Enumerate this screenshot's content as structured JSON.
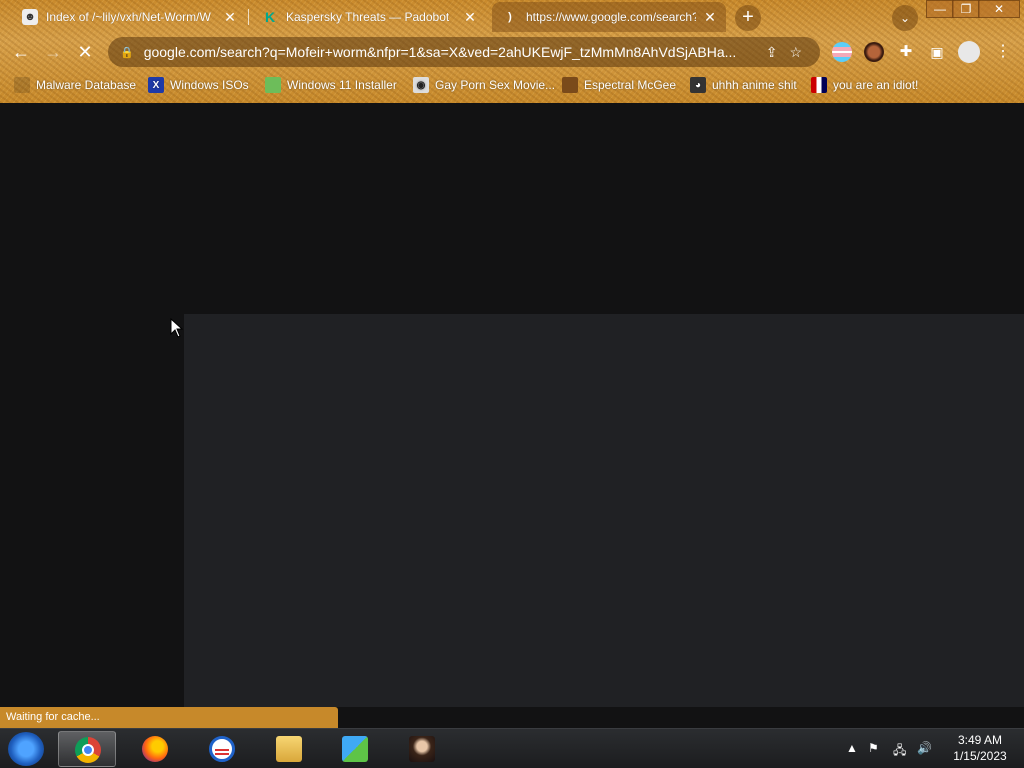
{
  "tabs": [
    {
      "title": "Index of /~lily/vxh/Net-Worm/W",
      "close": "✕"
    },
    {
      "title": "Kaspersky Threats — Padobot",
      "close": "✕"
    },
    {
      "title": "https://www.google.com/search?",
      "close": "✕"
    }
  ],
  "new_tab": "+",
  "window_controls": {
    "minimize": "—",
    "maximize": "❐",
    "close": "✕"
  },
  "toolbar": {
    "url": "google.com/search?q=Mofeir+worm&nfpr=1&sa=X&ved=2ahUKEwjF_tzMmMn8AhVdSjABHa...",
    "back": "←",
    "forward": "→",
    "reload": "✕"
  },
  "bookmarks": [
    {
      "label": "Malware Database"
    },
    {
      "label": "Windows ISOs"
    },
    {
      "label": "Windows 11 Installer"
    },
    {
      "label": "Gay Porn Sex Movie..."
    },
    {
      "label": "Espectral McGee"
    },
    {
      "label": "uhhh anime shit"
    },
    {
      "label": "you are an idiot!"
    }
  ],
  "status": "Waiting for cache...",
  "clock": {
    "time": "3:49 AM",
    "date": "1/15/2023"
  },
  "colors": {
    "theme": "#c7892a",
    "page_bg": "#121213",
    "panel": "#202124"
  }
}
